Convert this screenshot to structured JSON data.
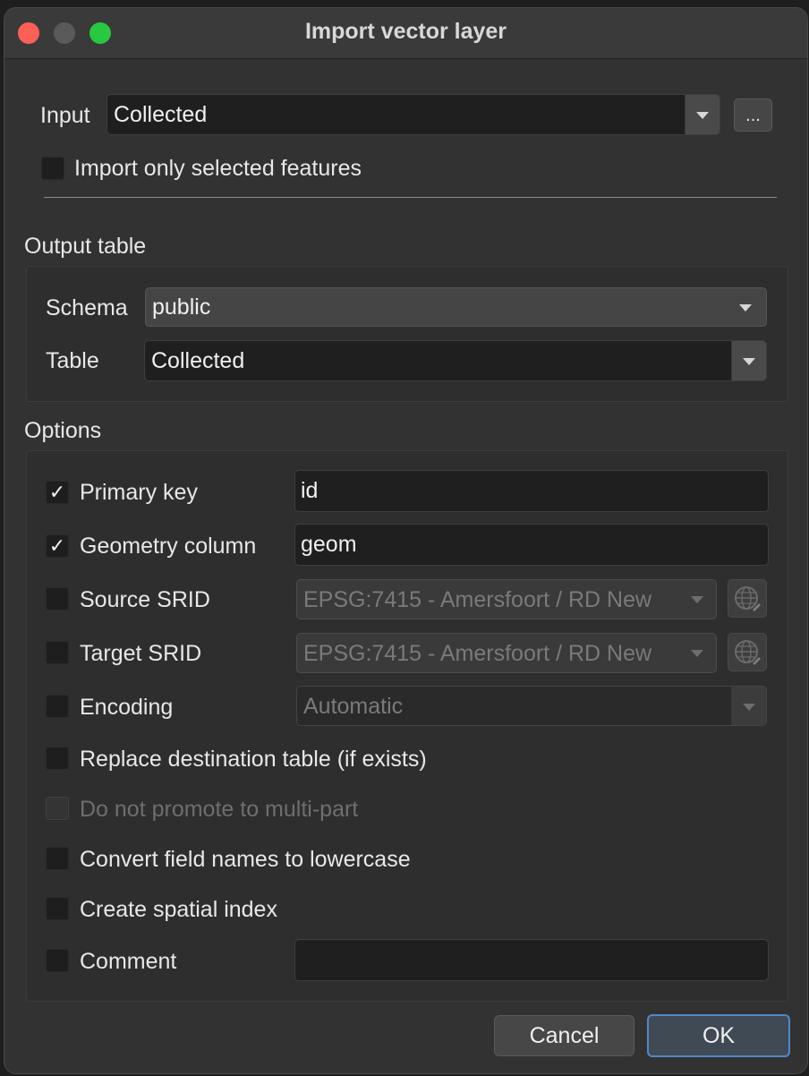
{
  "window": {
    "title": "Import vector layer"
  },
  "input": {
    "label": "Input",
    "value": "Collected",
    "browse_label": "...",
    "selected_only_label": "Import only selected features"
  },
  "output_table": {
    "heading": "Output table",
    "schema_label": "Schema",
    "schema_value": "public",
    "table_label": "Table",
    "table_value": "Collected"
  },
  "options": {
    "heading": "Options",
    "primary_key": {
      "label": "Primary key",
      "checked": true,
      "value": "id"
    },
    "geometry_column": {
      "label": "Geometry column",
      "checked": true,
      "value": "geom"
    },
    "source_srid": {
      "label": "Source SRID",
      "checked": false,
      "value": "EPSG:7415 - Amersfoort / RD New"
    },
    "target_srid": {
      "label": "Target SRID",
      "checked": false,
      "value": "EPSG:7415 - Amersfoort / RD New"
    },
    "encoding": {
      "label": "Encoding",
      "checked": false,
      "value": "Automatic"
    },
    "replace_table": {
      "label": "Replace destination table (if exists)",
      "checked": false
    },
    "no_promote": {
      "label": "Do not promote to multi-part",
      "checked": false,
      "disabled": true
    },
    "lowercase": {
      "label": "Convert field names to lowercase",
      "checked": false
    },
    "spatial_index": {
      "label": "Create spatial index",
      "checked": false
    },
    "comment": {
      "label": "Comment",
      "checked": false,
      "value": ""
    }
  },
  "buttons": {
    "cancel": "Cancel",
    "ok": "OK"
  },
  "colors": {
    "accent": "#4f89c7",
    "close": "#fe5f57",
    "zoom": "#28c840"
  },
  "check_glyph": "✓"
}
